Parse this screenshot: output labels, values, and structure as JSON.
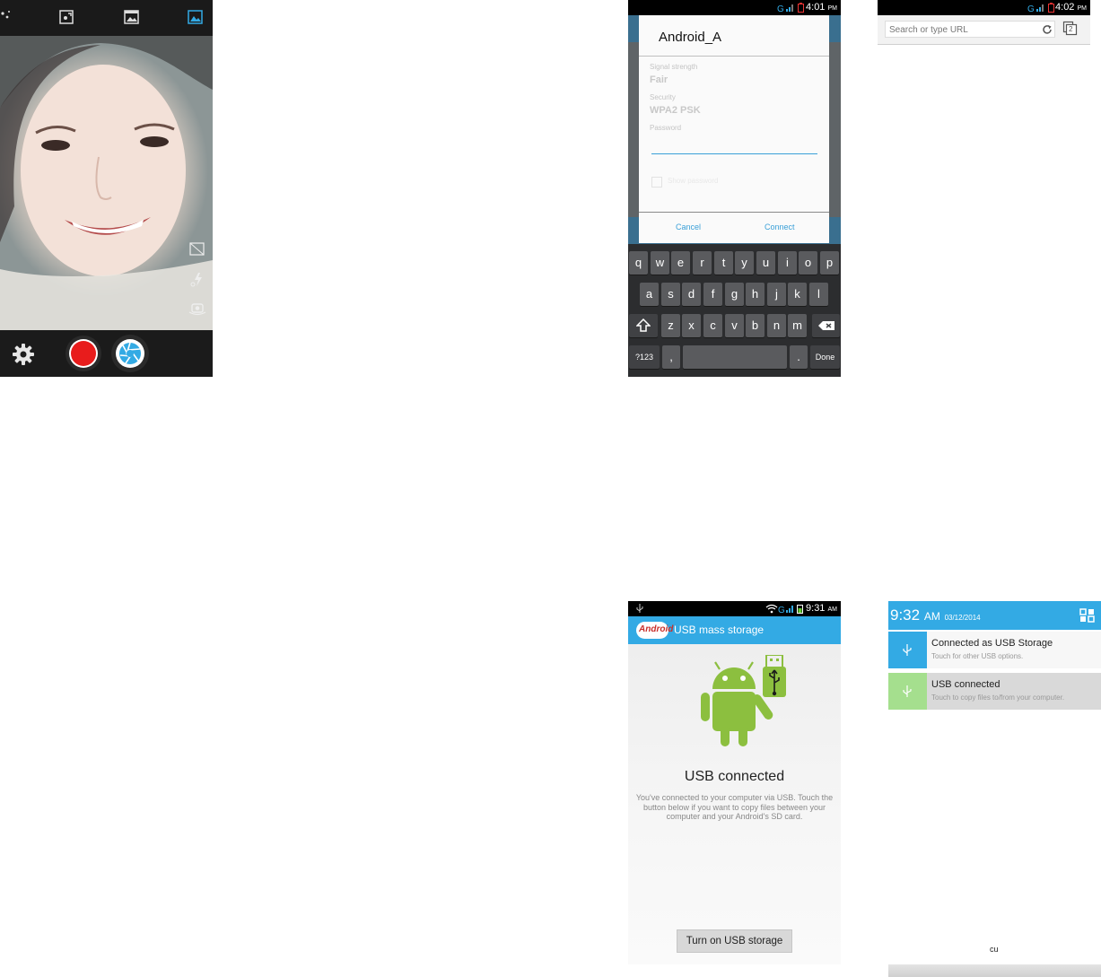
{
  "wifi_dialog": {
    "status_time": "4:01",
    "status_ampm": "PM",
    "title": "Android_A",
    "fields": [
      {
        "label": "Signal strength",
        "value": "Fair"
      },
      {
        "label": "Security",
        "value": "WPA2 PSK"
      },
      {
        "label": "Password",
        "value": ""
      }
    ],
    "show_password_label": "Show password",
    "cancel_label": "Cancel",
    "connect_label": "Connect",
    "keyboard": {
      "row1": [
        "q",
        "w",
        "e",
        "r",
        "t",
        "y",
        "u",
        "i",
        "o",
        "p"
      ],
      "row2": [
        "a",
        "s",
        "d",
        "f",
        "g",
        "h",
        "j",
        "k",
        "l"
      ],
      "row3": [
        "z",
        "x",
        "c",
        "v",
        "b",
        "n",
        "m"
      ],
      "sym_label": "?123",
      "comma_label": ",",
      "period_label": ".",
      "done_label": "Done"
    }
  },
  "browser": {
    "status_time": "4:02",
    "status_ampm": "PM",
    "url_placeholder": "Search or type URL",
    "tabs_count": "2"
  },
  "usb": {
    "status_time": "9:31",
    "status_ampm": "AM",
    "title": "USB mass storage",
    "logo_text": "Android",
    "heading": "USB connected",
    "description": "You've connected to your computer via USB. Touch the button below if you want to copy files between your computer and your Android's SD card.",
    "button_label": "Turn on USB storage"
  },
  "notifications": {
    "time": "9:32",
    "ampm": "AM",
    "date": "03/12/2014",
    "items": [
      {
        "title": "Connected as USB Storage",
        "subtitle": "Touch for other USB options.",
        "icon": "usb-icon"
      },
      {
        "title": "USB connected",
        "subtitle": "Touch to copy files to/from your computer.",
        "icon": "usb-icon"
      }
    ],
    "bottom_text": "cu"
  },
  "colors": {
    "accent": "#33aae4",
    "record": "#e81c1c",
    "android_green": "#8cbf3f"
  }
}
